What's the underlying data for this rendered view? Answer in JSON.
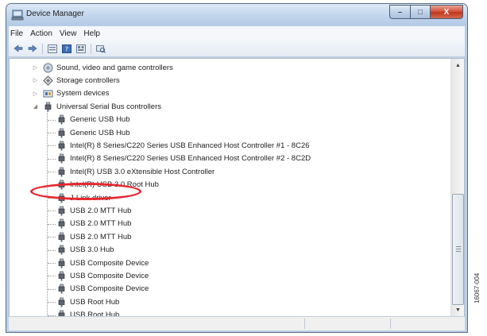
{
  "window": {
    "title": "Device Manager",
    "caption_buttons": {
      "minimize": "–",
      "maximize": "□",
      "close": "X"
    }
  },
  "menu": {
    "items": [
      "File",
      "Action",
      "View",
      "Help"
    ]
  },
  "toolbar": {
    "buttons": [
      "back-icon",
      "forward-icon",
      "properties-icon",
      "help-icon",
      "update-driver-icon",
      "scan-hardware-icon"
    ]
  },
  "tree": {
    "categories": [
      {
        "label": "Sound, video and game controllers",
        "state": "collapsed",
        "icon": "speaker-icon"
      },
      {
        "label": "Storage controllers",
        "state": "collapsed",
        "icon": "storage-icon"
      },
      {
        "label": "System devices",
        "state": "collapsed",
        "icon": "system-devices-icon"
      },
      {
        "label": "Universal Serial Bus controllers",
        "state": "expanded",
        "icon": "usb-icon"
      }
    ],
    "usb_devices": [
      "Generic USB Hub",
      "Generic USB Hub",
      "Intel(R) 8 Series/C220 Series USB Enhanced Host Controller #1 - 8C26",
      "Intel(R) 8 Series/C220 Series USB Enhanced Host Controller #2 - 8C2D",
      "Intel(R) USB 3.0 eXtensible Host Controller",
      "Intel(R) USB 3.0 Root Hub",
      "J-Link driver",
      "USB 2.0 MTT Hub",
      "USB 2.0 MTT Hub",
      "USB 2.0 MTT Hub",
      "USB 3.0 Hub",
      "USB Composite Device",
      "USB Composite Device",
      "USB Composite Device",
      "USB Root Hub",
      "USB Root Hub"
    ],
    "highlighted_device": "J-Link driver"
  },
  "figure_id": "16067-004",
  "colors": {
    "highlight": "#e8262f",
    "titlebar": "#c4d7ee",
    "close_button": "#c1361d"
  }
}
